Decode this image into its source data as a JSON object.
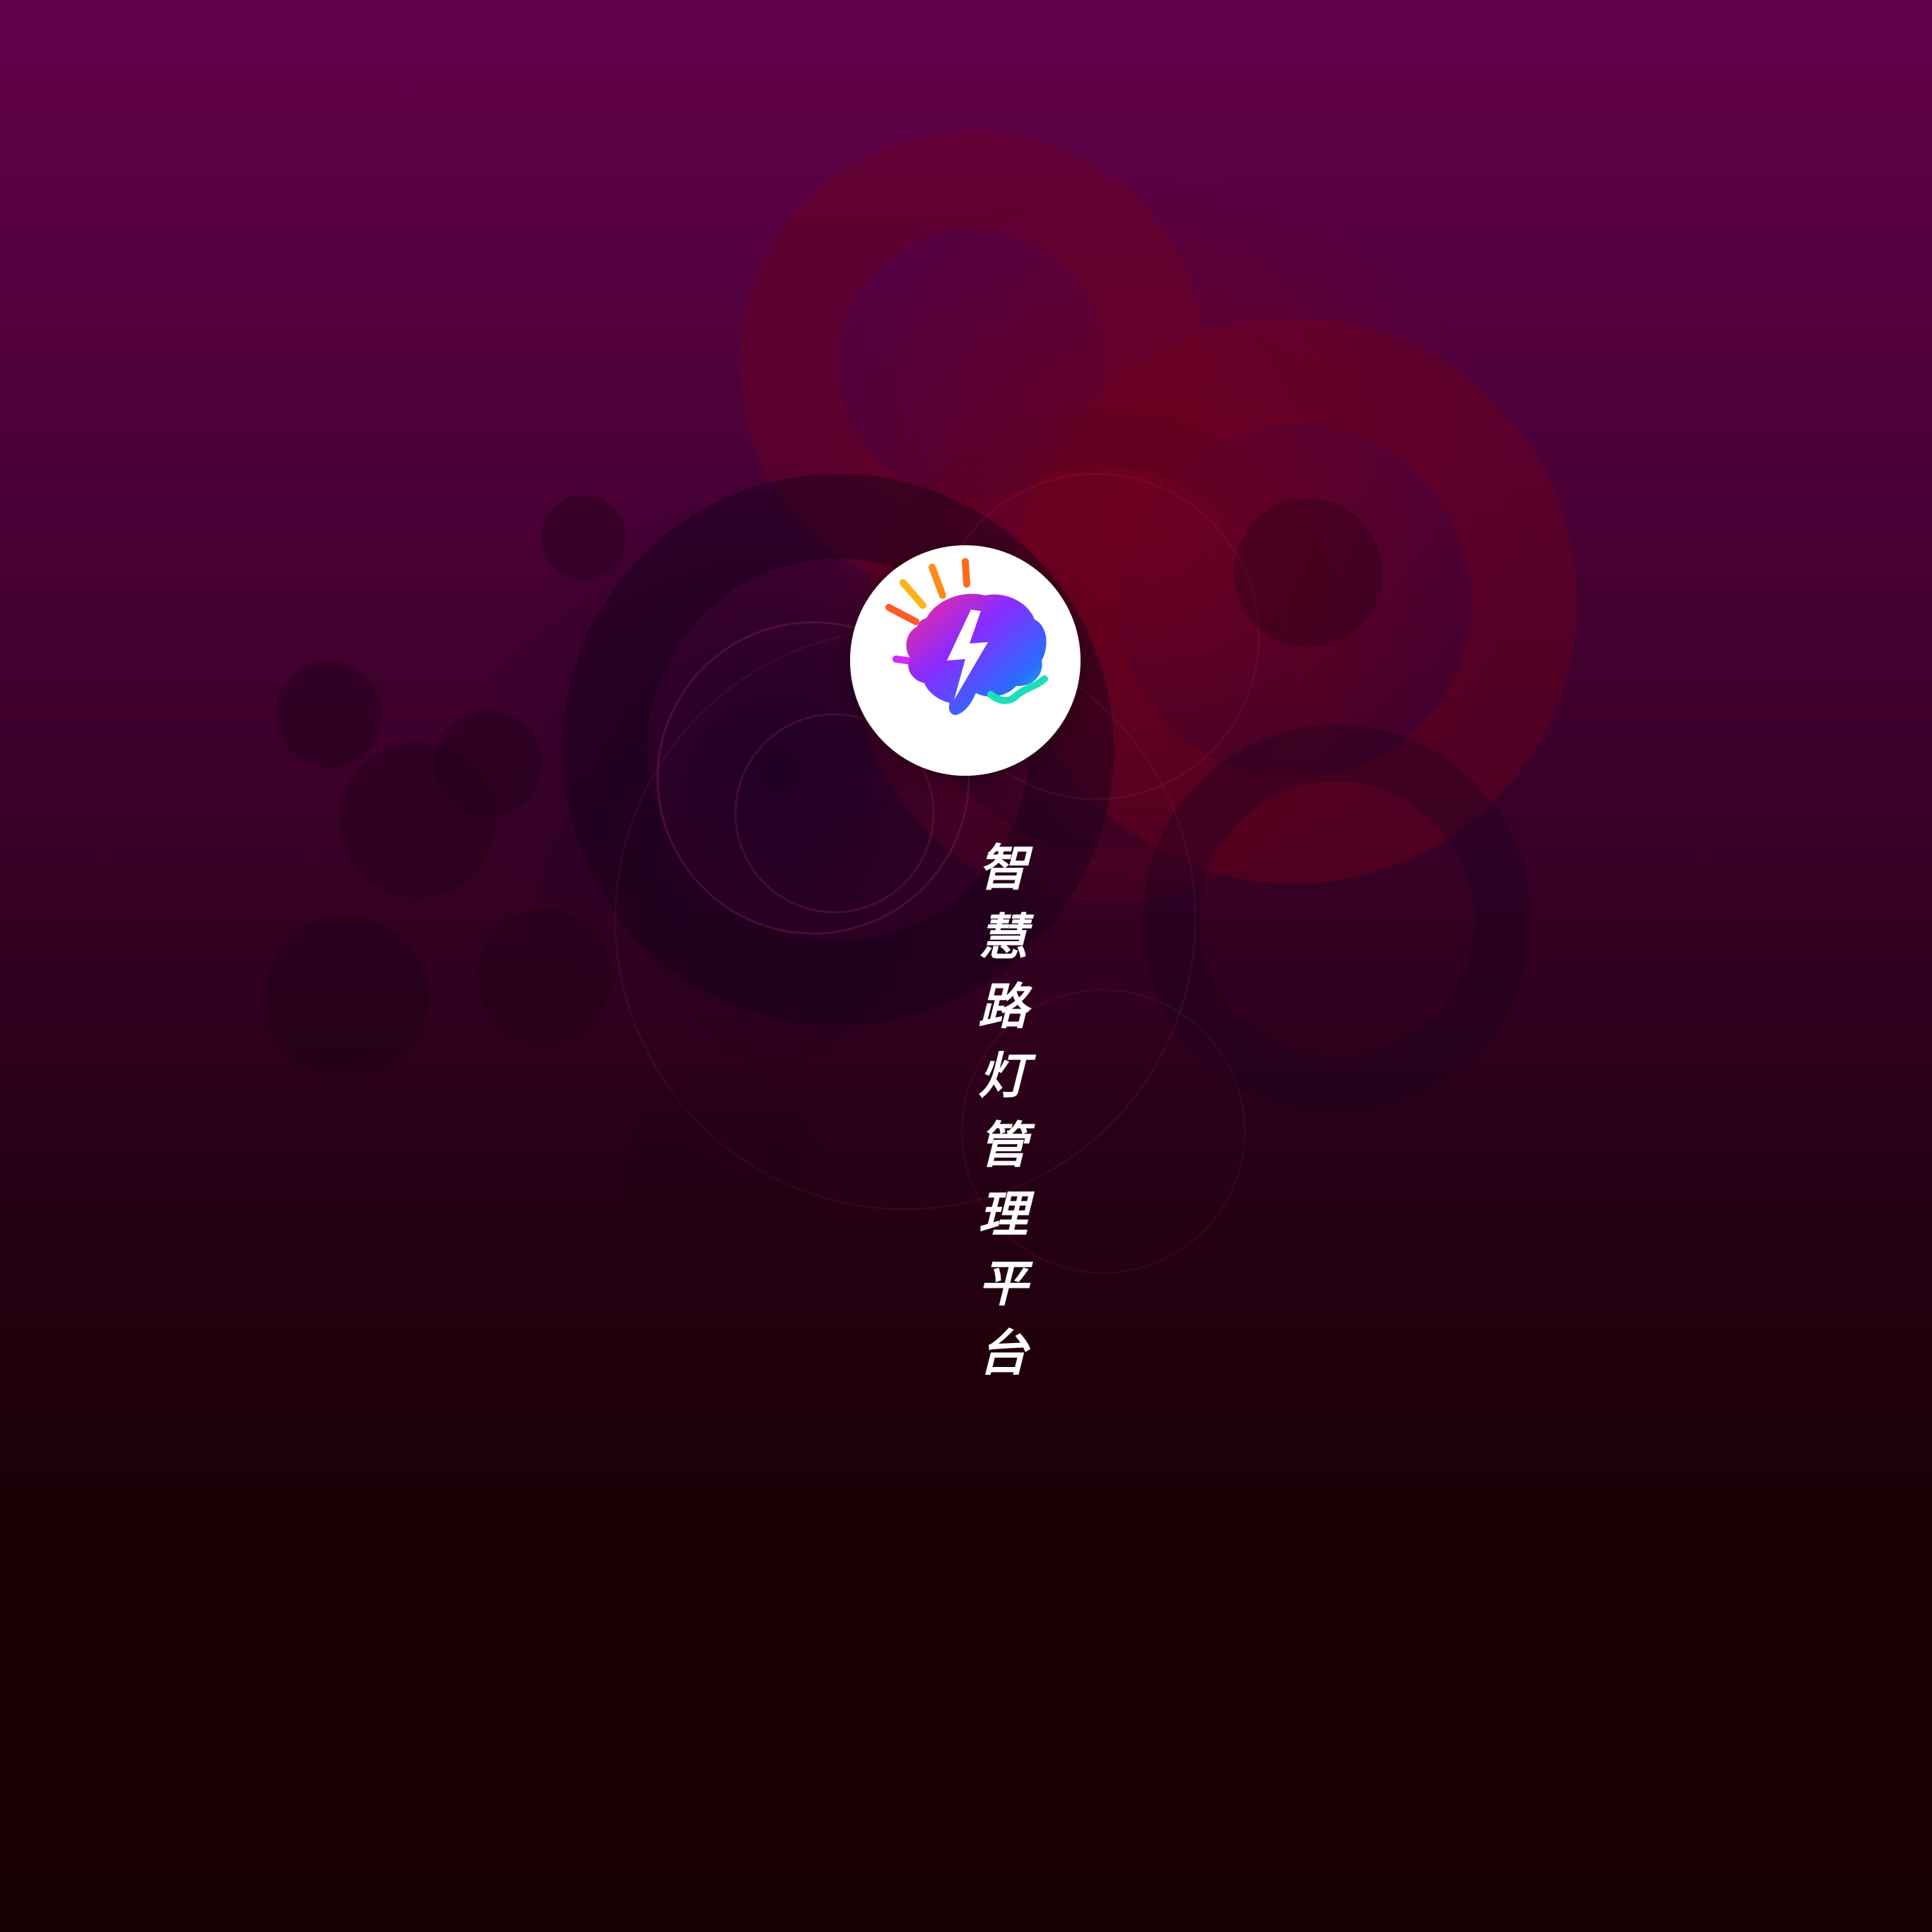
{
  "app": {
    "title": "智慧路灯管理平台",
    "logo_icon": "brain-lightning-icon"
  },
  "colors": {
    "background_top": "#62004a",
    "background_bottom": "#170002",
    "badge": "#ffffff",
    "title_text": "#ffffff"
  }
}
